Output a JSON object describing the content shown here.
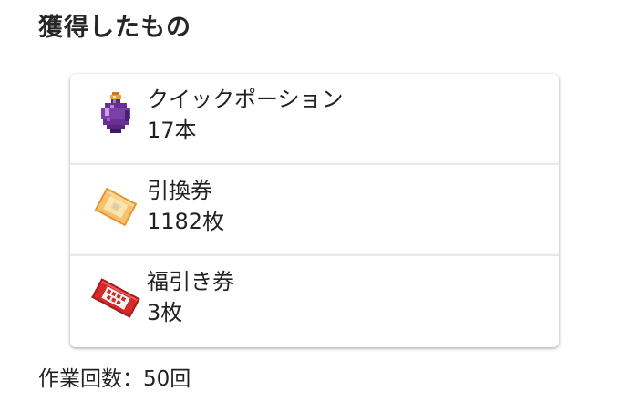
{
  "header": {
    "title": "獲得したもの"
  },
  "items": [
    {
      "icon": "purple-potion-icon",
      "name": "クイックポーション",
      "count": "17本"
    },
    {
      "icon": "exchange-ticket-icon",
      "name": "引換券",
      "count": "1182枚"
    },
    {
      "icon": "lottery-ticket-icon",
      "name": "福引き券",
      "count": "3枚"
    }
  ],
  "footer": {
    "work_count_text": "作業回数：50回"
  },
  "colors": {
    "potion_purple": "#7b3fa8",
    "ticket_orange": "#f3b565",
    "lottery_red": "#d42a2a"
  }
}
